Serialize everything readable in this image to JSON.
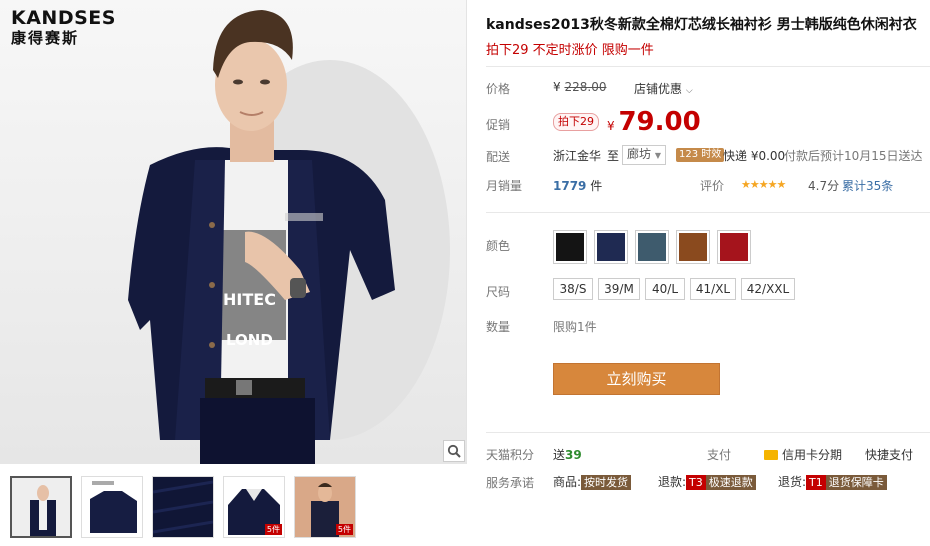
{
  "brand": {
    "name_en": "KANDSES",
    "name_cn": "康得赛斯"
  },
  "product": {
    "title": "kandses2013秋冬新款全棉灯芯绒长袖衬衫 男士韩版纯色休闲衬衣",
    "promo": "拍下29 不定时涨价 限购一件"
  },
  "price": {
    "label": "价格",
    "currency": "¥",
    "original": "228.00",
    "store_discount": "店铺优惠",
    "promo_label": "促销",
    "promo_tag": "拍下29",
    "current": "79.00"
  },
  "shipping": {
    "label": "配送",
    "from": "浙江金华",
    "to_label": "至",
    "to": "廊坊",
    "time_tag": "123 时效",
    "fee": "快递 ¥0.00",
    "eta": "付款后预计10月15日送达"
  },
  "sales": {
    "label": "月销量",
    "count": "1779",
    "unit": "件",
    "rating_label": "评价",
    "stars": "★★★★★",
    "score": "4.7分",
    "reviews": "累计35条"
  },
  "options": {
    "color_label": "颜色",
    "colors": [
      "#141414",
      "#1f2a52",
      "#3e5b6d",
      "#8a4a1e",
      "#a5141c"
    ],
    "size_label": "尺码",
    "sizes": [
      "38/S",
      "39/M",
      "40/L",
      "41/XL",
      "42/XXL"
    ],
    "qty_label": "数量",
    "qty_limit": "限购1件"
  },
  "buy_button": "立刻购买",
  "footer": {
    "points_label": "天猫积分",
    "points_prefix": "送",
    "points": "39",
    "pay_label": "支付",
    "credit_card": "信用卡分期",
    "quick_pay": "快捷支付",
    "service_label": "服务承诺",
    "goods_label": "商品:",
    "goods_tag": "按时发货",
    "refund_label": "退款:",
    "refund_code": "T3",
    "refund_tag": "极速退款",
    "return_label": "退货:",
    "return_code": "T1",
    "return_tag": "退货保障卡"
  },
  "thumbnails": {
    "badges": [
      "",
      "",
      "",
      "5件",
      "5件"
    ]
  },
  "colors": {
    "accent_red": "#c40000",
    "buy_orange": "#d7873c"
  },
  "icons": {
    "zoom": "magnifier-icon",
    "dropdown": "chevron-down-icon",
    "card": "credit-card-icon"
  }
}
